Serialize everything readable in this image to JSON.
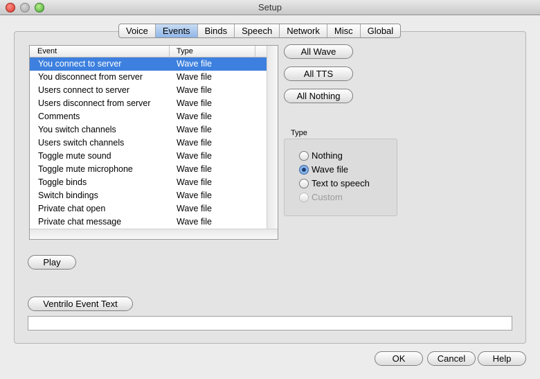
{
  "window": {
    "title": "Setup"
  },
  "tabs": [
    {
      "label": "Voice"
    },
    {
      "label": "Events"
    },
    {
      "label": "Binds"
    },
    {
      "label": "Speech"
    },
    {
      "label": "Network"
    },
    {
      "label": "Misc"
    },
    {
      "label": "Global"
    }
  ],
  "active_tab": "Events",
  "events_table": {
    "columns": {
      "event": "Event",
      "type": "Type"
    },
    "rows": [
      {
        "event": "You connect to server",
        "type": "Wave file",
        "selected": true
      },
      {
        "event": "You disconnect from server",
        "type": "Wave file"
      },
      {
        "event": "Users connect to server",
        "type": "Wave file"
      },
      {
        "event": "Users disconnect from server",
        "type": "Wave file"
      },
      {
        "event": "Comments",
        "type": "Wave file"
      },
      {
        "event": "You switch channels",
        "type": "Wave file"
      },
      {
        "event": "Users switch channels",
        "type": "Wave file"
      },
      {
        "event": "Toggle mute sound",
        "type": "Wave file"
      },
      {
        "event": "Toggle mute microphone",
        "type": "Wave file"
      },
      {
        "event": "Toggle binds",
        "type": "Wave file"
      },
      {
        "event": "Switch bindings",
        "type": "Wave file"
      },
      {
        "event": "Private chat open",
        "type": "Wave file"
      },
      {
        "event": "Private chat message",
        "type": "Wave file"
      }
    ]
  },
  "bulk_buttons": {
    "all_wave": "All Wave",
    "all_tts": "All TTS",
    "all_nothing": "All Nothing"
  },
  "type_group": {
    "label": "Type",
    "options": {
      "nothing": "Nothing",
      "wave_file": "Wave file",
      "text_to_speech": "Text to speech",
      "custom": "Custom"
    },
    "selected": "Wave file"
  },
  "play_button": "Play",
  "event_text_button": "Ventrilo Event Text",
  "event_text_value": "",
  "footer": {
    "ok": "OK",
    "cancel": "Cancel",
    "help": "Help"
  },
  "colors": {
    "selection": "#3d80df",
    "active_tab": "#8fb6e8"
  }
}
